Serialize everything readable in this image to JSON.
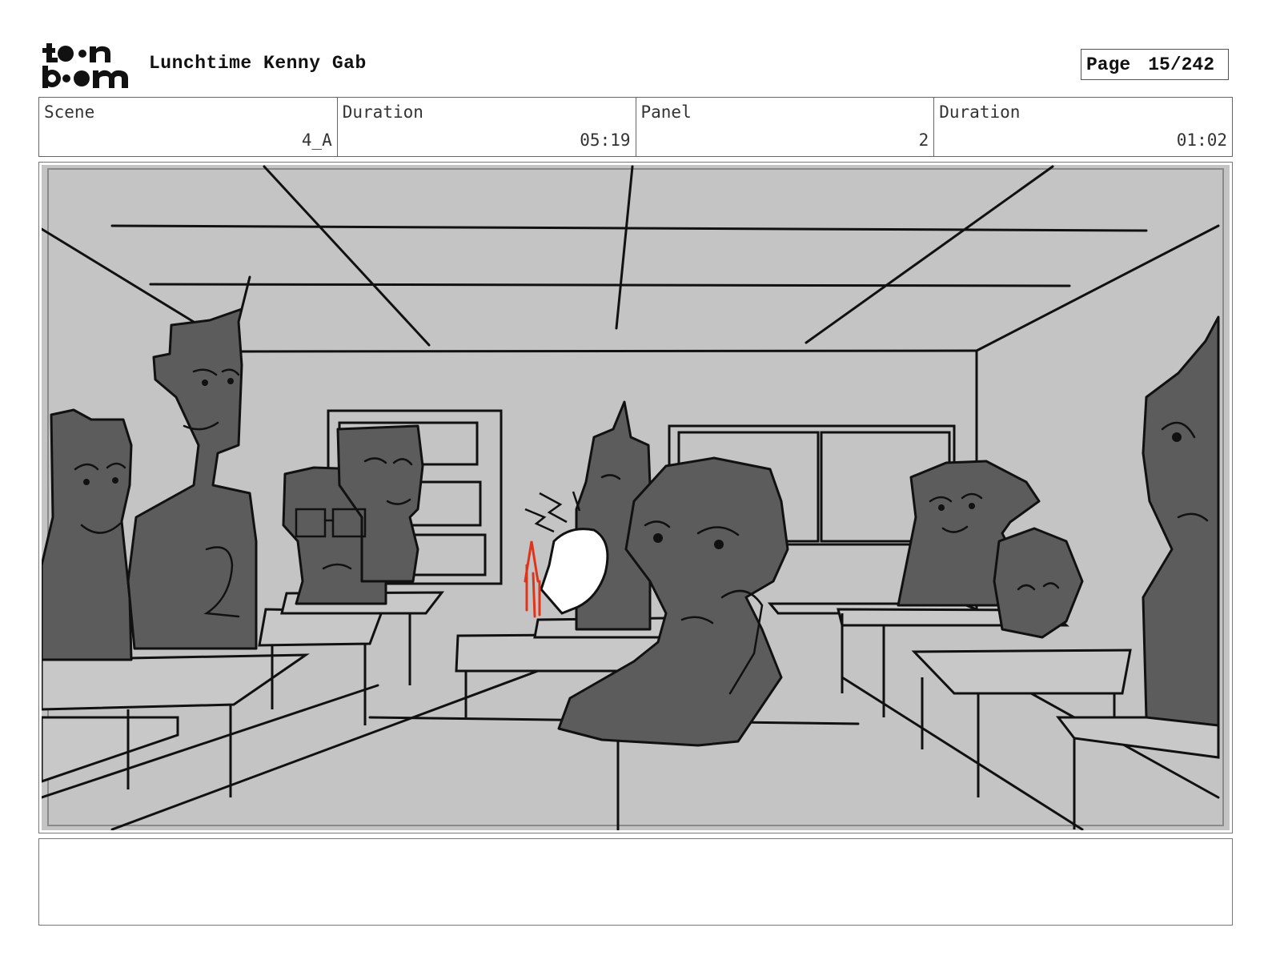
{
  "header": {
    "logo_icon": "toonboom-logo",
    "project_title": "Lunchtime Kenny Gab",
    "page_label": "Page",
    "page_number": "15/242"
  },
  "info": {
    "scene_label": "Scene",
    "scene_value": "4_A",
    "scene_duration_label": "Duration",
    "scene_duration_value": "05:19",
    "panel_label": "Panel",
    "panel_value": "2",
    "panel_duration_label": "Duration",
    "panel_duration_value": "01:02"
  },
  "panel_image": {
    "description_icon": "classroom-storyboard-sketch",
    "colors": {
      "background": "#c4c4c4",
      "figure": "#5c5c5c",
      "ink": "#111111",
      "accent": "#e0341a"
    }
  },
  "notes": {
    "text": ""
  }
}
